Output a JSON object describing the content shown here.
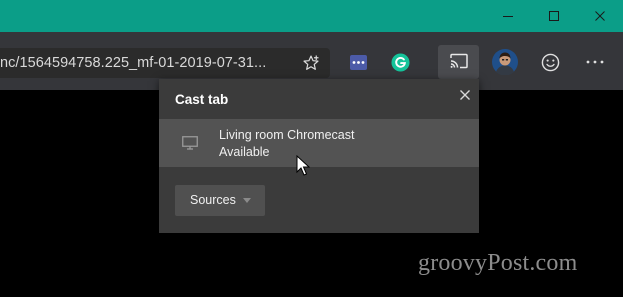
{
  "window": {
    "titlebar_color": "#0b9e88",
    "controls": [
      {
        "name": "minimize-icon"
      },
      {
        "name": "maximize-icon"
      },
      {
        "name": "close-icon"
      }
    ]
  },
  "address_bar": {
    "url_text": "nc/1564594758.225_mf-01-2019-07-31..."
  },
  "toolbar": {
    "icons": [
      "favorite-star-icon",
      "extension-dots-icon",
      "grammarly-icon",
      "cast-icon",
      "profile-avatar",
      "feedback-smiley-icon",
      "more-menu-icon"
    ],
    "extension_badge_color": "#4c5ba8",
    "grammarly_color": "#15c39a"
  },
  "cast_popup": {
    "title": "Cast tab",
    "device": {
      "name": "Living room Chromecast",
      "status": "Available",
      "icon": "monitor-icon"
    },
    "sources_label": "Sources"
  },
  "watermark": "groovyPost.com"
}
